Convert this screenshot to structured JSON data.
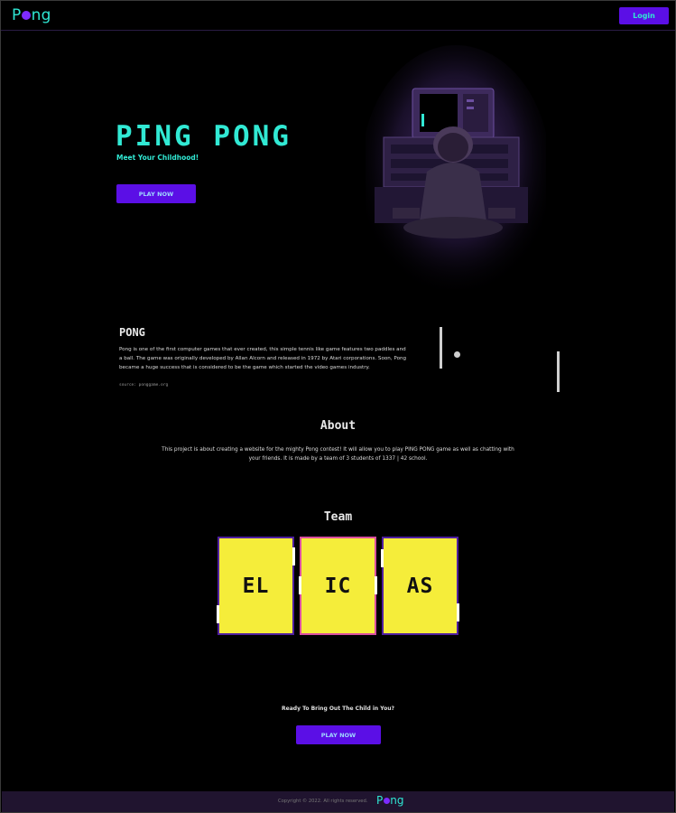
{
  "nav": {
    "logo_prefix": "P",
    "logo_suffix": "ng",
    "login_label": "Login"
  },
  "hero": {
    "title": "PING PONG",
    "subtitle": "Meet Your Childhood!",
    "play_label": "PLAY NOW"
  },
  "pong": {
    "title": "PONG",
    "text": "Pong is one of the first computer games that ever created, this simple tennis like game features two paddles and a ball. The game was originally developed by Allan Alcorn and released in 1972 by Atari corporations. Soon, Pong became a huge success that is considered to be the game which started the video games industry.",
    "source": "source: ponggame.org"
  },
  "about": {
    "title": "About",
    "text": "This project is about creating a website for the mighty Pong contest! It will allow you to play PING PONG game as well as chatting with your friends. It is made by a team of 3 students of 1337 | 42 school."
  },
  "team": {
    "title": "Team",
    "members": [
      "EL",
      "IC",
      "AS"
    ]
  },
  "cta": {
    "text": "Ready To Bring Out The Child in You?",
    "play_label": "PLAY NOW"
  },
  "footer": {
    "copyright": "Copyright © 2022. All rights reserved.",
    "logo_prefix": "P",
    "logo_suffix": "ng"
  },
  "colors": {
    "accent": "#31e9d4",
    "button": "#5b0fe6",
    "card": "#f5ed3a",
    "footer": "#20142f"
  }
}
